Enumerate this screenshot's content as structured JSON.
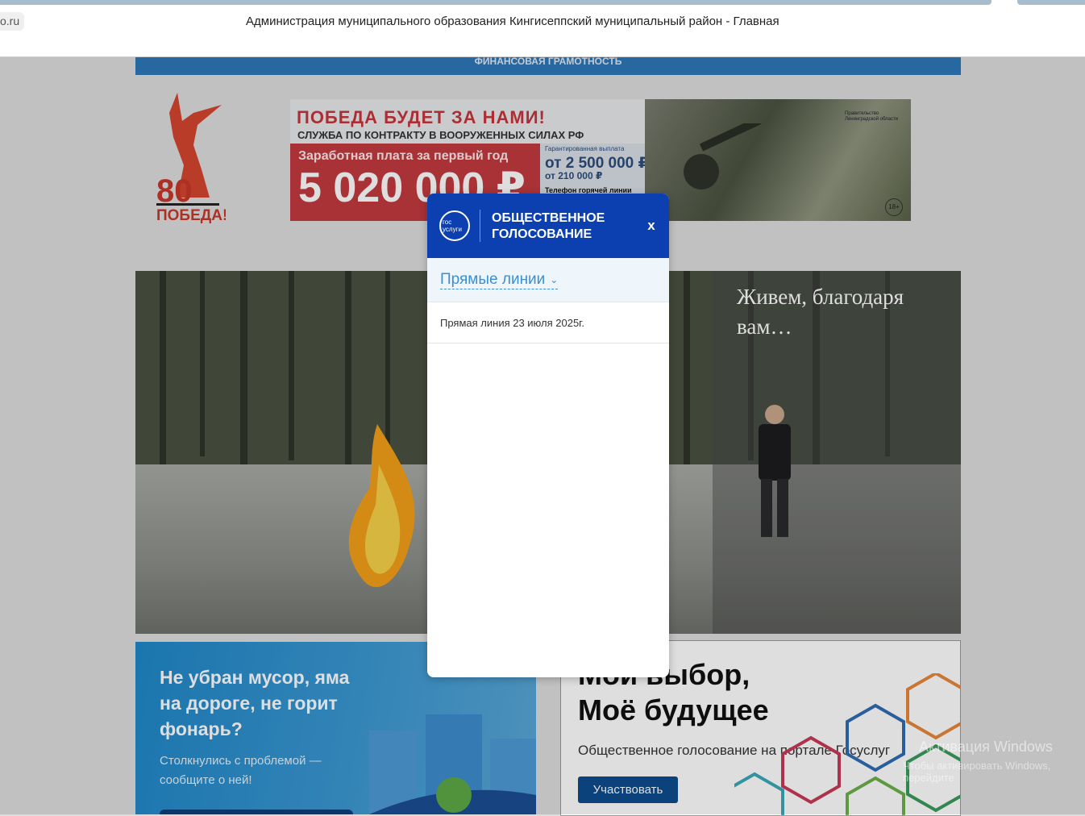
{
  "browser": {
    "url_suffix": "o.ru",
    "page_title": "Администрация муниципального образования Кингисеппский муниципальный район - Главная"
  },
  "topbar": {
    "label": "ФИНАНСОВАЯ ГРАМОТНОСТЬ"
  },
  "victory_logo": {
    "number": "80",
    "word": "ПОБЕДА!"
  },
  "banner": {
    "headline": "ПОБЕДА БУДЕТ ЗА НАМИ!",
    "subhead": "СЛУЖБА ПО КОНТРАКТУ В ВООРУЖЕННЫХ СИЛАХ РФ",
    "salary_label": "Заработная плата за первый год",
    "salary_value": "5 020 000 ₽",
    "guarantee_label": "Гарантированная выплата",
    "amount1": "от 2 500 000 ₽",
    "amount2": "от 210 000 ₽",
    "hotline": "Телефон горячей линии",
    "gov_badge": "Правительство Ленинградской области",
    "age_rating": "18+"
  },
  "hero": {
    "caption": "Живем, благодаря вам…"
  },
  "card_left": {
    "title": "Не убран мусор, яма на дороге, не горит фонарь?",
    "text": "Столкнулись с проблемой — сообщите о ней!"
  },
  "card_right": {
    "title_line1": "Мой выбор,",
    "title_line2": "Моё будущее",
    "text": "Общественное голосование на портале Госуслуг",
    "button": "Участвовать"
  },
  "watermark": {
    "line1": "Активация Windows",
    "line2": "Чтобы активировать Windows, перейдите"
  },
  "modal": {
    "logo_text_top": "гос",
    "logo_text_bottom": "услуги",
    "title": "ОБЩЕСТВЕННОЕ ГОЛОСОВАНИЕ",
    "close_label": "x",
    "dropdown_label": "Прямые линии",
    "items": [
      {
        "label": "Прямая линия 23 июля 2025г."
      }
    ]
  },
  "colors": {
    "modal_header": "#0c40b0",
    "link": "#3b8fd1",
    "topbar": "#2f78b8",
    "participate_button": "#0d4c8e"
  }
}
